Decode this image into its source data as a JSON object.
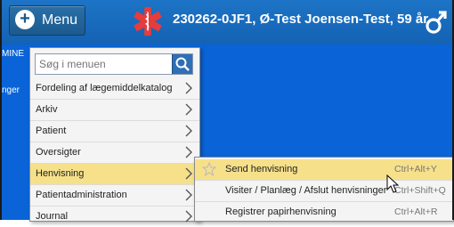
{
  "header": {
    "menu_label": "Menu",
    "patient_info": "230262-0JF1, Ø-Test Joensen-Test, 59 år",
    "star_icon": "star-of-life-icon",
    "gender_icon": "male-symbol-icon",
    "colors": {
      "bar": "#1d74c6",
      "star": "#e83b3b"
    }
  },
  "desktop": {
    "colors": {
      "background": "#0a64d8"
    },
    "snippets": [
      "MINE",
      "nger"
    ]
  },
  "dropdown": {
    "search_placeholder": "Søg i menuen",
    "items": [
      {
        "label": "Fordeling af lægemiddelkatalog"
      },
      {
        "label": "Arkiv"
      },
      {
        "label": "Patient"
      },
      {
        "label": "Oversigter"
      },
      {
        "label": "Henvisning"
      },
      {
        "label": "Patientadministration"
      },
      {
        "label": "Journal"
      }
    ],
    "highlight_color": "#f6e08a"
  },
  "submenu": {
    "items": [
      {
        "label": "Send henvisning",
        "shortcut": "Ctrl+Alt+Y"
      },
      {
        "label": "Visiter / Planlæg / Afslut henvisninger",
        "shortcut": "Ctrl+Shift+Q"
      },
      {
        "label": "Registrer papirhenvisning",
        "shortcut": "Ctrl+Alt+R"
      }
    ]
  }
}
